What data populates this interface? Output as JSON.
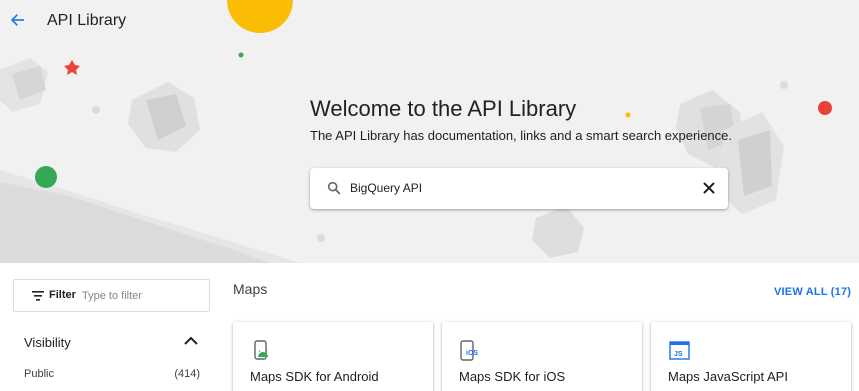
{
  "header": {
    "title": "API Library",
    "back_icon": "arrow-left-icon"
  },
  "hero": {
    "heading": "Welcome to the API Library",
    "subtitle": "The API Library has documentation, links and a smart search experience."
  },
  "search": {
    "value": "BigQuery API",
    "icon": "search-icon",
    "clear_icon": "close-icon"
  },
  "sidebar": {
    "filter_label": "Filter",
    "filter_placeholder": "Type to filter",
    "visibility": {
      "label": "Visibility",
      "expanded": true,
      "items": [
        {
          "label": "Public",
          "count": "(414)"
        }
      ]
    }
  },
  "main": {
    "section_title": "Maps",
    "view_all_label": "VIEW ALL (17)",
    "cards": [
      {
        "title": "Maps SDK for Android",
        "icon": "android-maps-icon"
      },
      {
        "title": "Maps SDK for iOS",
        "icon": "ios-icon"
      },
      {
        "title": "Maps JavaScript API",
        "icon": "js-icon"
      }
    ]
  },
  "colors": {
    "accent": "#1a73e8",
    "hero_bg": "#f1f1f1",
    "yellow": "#fbbc04",
    "red": "#ea4335",
    "green": "#34a853"
  }
}
